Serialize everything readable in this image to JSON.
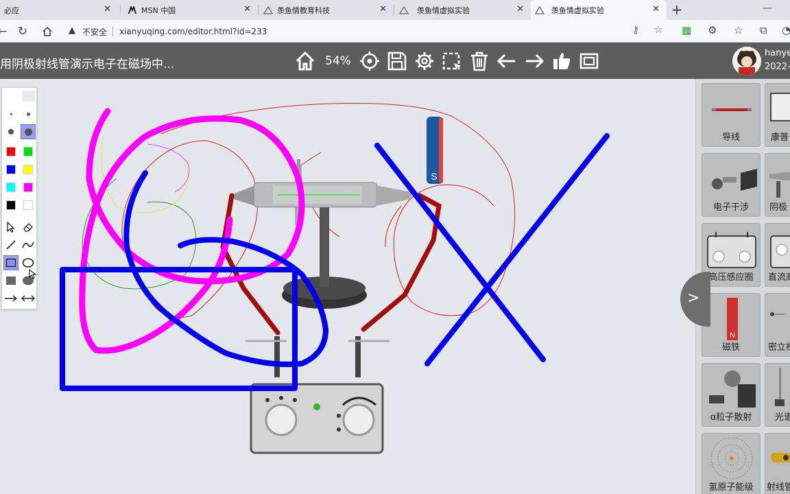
{
  "browser": {
    "tabs": [
      {
        "label": "必应",
        "favicon": "bing-icon"
      },
      {
        "label": "MSN 中国",
        "favicon": "msn-icon"
      },
      {
        "label": "羡鱼情教育科技",
        "favicon": "xianyuqing-icon"
      },
      {
        "label": "羡鱼情虚拟实验",
        "favicon": "xianyuqing-icon"
      },
      {
        "label": "羡鱼情虚拟实验",
        "favicon": "xianyuqing-icon",
        "active": true
      }
    ],
    "security_label": "不安全",
    "url": "xianyuqing.com/editor.html?id=233"
  },
  "app": {
    "title": "用阴极射线管演示电子在磁场中...",
    "zoom": "54%",
    "user": {
      "name": "hanye",
      "date": "2022-"
    }
  },
  "palette": {
    "colors": [
      "#ff0000",
      "#00e000",
      "#0000ff",
      "#ffff00",
      "#00ffff",
      "#ff00ff",
      "#000000",
      "#ffffff"
    ],
    "tools": [
      "pointer-icon",
      "eraser-icon",
      "line-icon",
      "freehand-icon",
      "rectangle-icon",
      "ellipse-icon",
      "filled-rect-icon",
      "filled-ellipse-icon",
      "arrow-icon",
      "double-arrow-icon"
    ]
  },
  "library": {
    "items": [
      {
        "label": "导线"
      },
      {
        "label": "康普"
      },
      {
        "label": "电子干涉"
      },
      {
        "label": "阴极"
      },
      {
        "label": "高压感应圈"
      },
      {
        "label": "直流高"
      },
      {
        "label": "磁铁"
      },
      {
        "label": "密立根"
      },
      {
        "label": "α粒子散射"
      },
      {
        "label": "光谱"
      },
      {
        "label": "氢原子能级"
      },
      {
        "label": "射线管"
      }
    ]
  },
  "scene": {
    "magnet_pole": "S",
    "colors": {
      "annotation_magenta": "#ff00ff",
      "annotation_blue": "#0000ee",
      "annotation_red": "#e02020",
      "wire": "#a01010"
    }
  }
}
